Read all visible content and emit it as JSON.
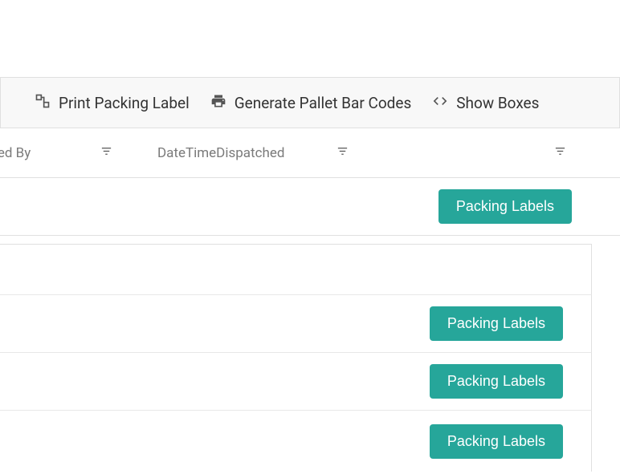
{
  "toolbar": {
    "print_packing_label": "Print Packing Label",
    "generate_pallet_barcodes": "Generate Pallet Bar Codes",
    "show_boxes": "Show Boxes"
  },
  "header": {
    "labelled_by": "belled By",
    "datetime_dispatched": "DateTimeDispatched"
  },
  "button_label": "Packing Labels",
  "colors": {
    "accent": "#26a69a"
  }
}
